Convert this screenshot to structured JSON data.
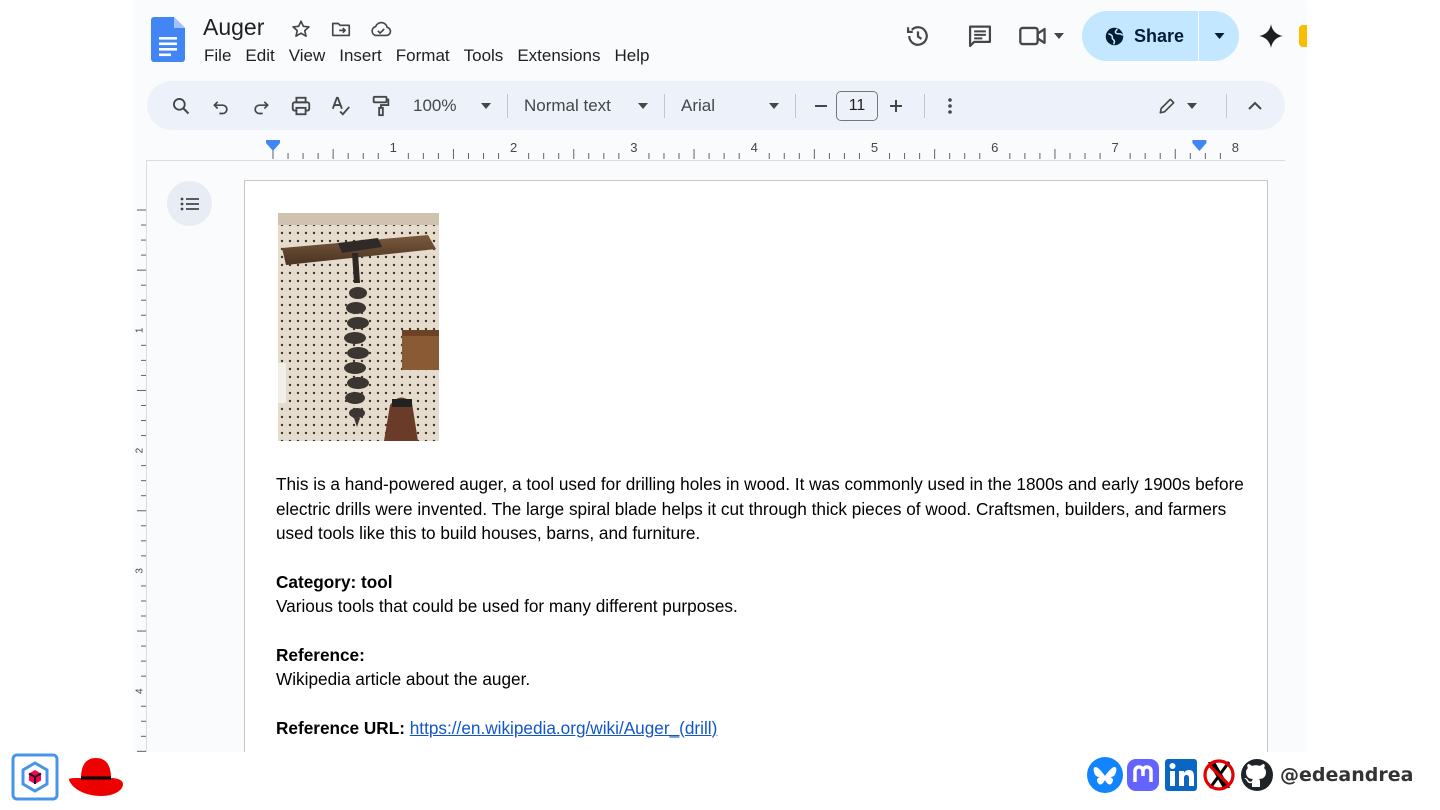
{
  "document": {
    "title": "Auger",
    "menu": [
      "File",
      "Edit",
      "View",
      "Insert",
      "Format",
      "Tools",
      "Extensions",
      "Help"
    ]
  },
  "header": {
    "share_label": "Share"
  },
  "toolbar": {
    "zoom": "100%",
    "paragraph_style": "Normal text",
    "font": "Arial",
    "font_size": "11"
  },
  "ruler": {
    "labels": [
      "1",
      "2",
      "3",
      "4",
      "5",
      "6",
      "7",
      "8"
    ],
    "vertical_labels": [
      "1",
      "2",
      "3",
      "4"
    ]
  },
  "content": {
    "description": "This is a hand-powered auger, a tool used for drilling holes in wood. It was commonly used in the 1800s and early 1900s before electric drills were invented. The large spiral blade helps it cut through thick pieces of wood. Craftsmen, builders, and farmers used tools like this to build houses, barns, and furniture.",
    "category_heading": "Category: tool",
    "category_text": "Various tools that could be used for many different purposes.",
    "reference_heading": "Reference:",
    "reference_text": "Wikipedia article about the auger.",
    "reference_url_label": "Reference URL:",
    "reference_url": "https://en.wikipedia.org/wiki/Auger_(drill)"
  },
  "footer": {
    "handle": "@edeandrea"
  },
  "icons": {
    "docs_logo": "google-docs-icon",
    "star": "star-icon",
    "move": "folder-move-icon",
    "cloud": "cloud-status-icon",
    "history": "history-icon",
    "comments": "comment-icon",
    "meet": "video-camera-icon",
    "globe": "globe-icon",
    "gemini": "sparkle-icon"
  },
  "colors": {
    "share_bg": "#c2e7ff",
    "toolbar_bg": "#edf2fa",
    "link": "#1155cc",
    "docs_blue": "#4285f4"
  }
}
